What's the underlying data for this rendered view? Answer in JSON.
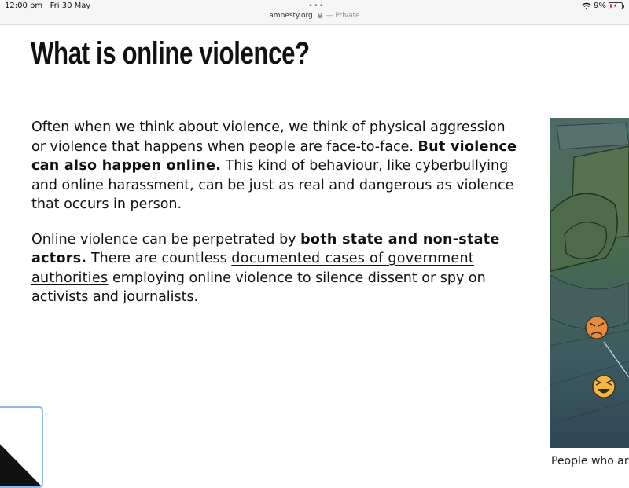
{
  "status_bar": {
    "time": "12:00 pm",
    "date": "Fri 30 May",
    "battery": "9%",
    "battery_level": 0.09
  },
  "address_bar": {
    "domain": "amnesty.org",
    "mode": "— Private"
  },
  "article": {
    "title": "What is online violence?",
    "p1_a": "Often when we think about violence, we think of physical aggression or violence that happens when people are face-to-face. ",
    "p1_bold": "But violence can also happen online.",
    "p1_b": " This kind of behaviour, like cyberbullying and online harassment, can be just as real and dangerous as violence that occurs in person.",
    "p2_a": "Online violence can be perpetrated by ",
    "p2_bold": "both state and non-state actors.",
    "p2_b": " There are countless ",
    "p2_link": "documented cases of government authorities",
    "p2_c": " employing online violence to silence dissent or spy on activists and journalists."
  },
  "figure": {
    "caption": "People who are"
  },
  "icons": {
    "wifi": "wifi-icon",
    "battery": "battery-icon",
    "lock": "lock-icon",
    "more": "more-dots-icon",
    "angry": "angry-emoji-icon",
    "laugh": "laughing-emoji-icon"
  },
  "colors": {
    "battery_low": "#e53935",
    "illustration_bg": "#3f5c58",
    "emoji": "#f4b63f"
  }
}
